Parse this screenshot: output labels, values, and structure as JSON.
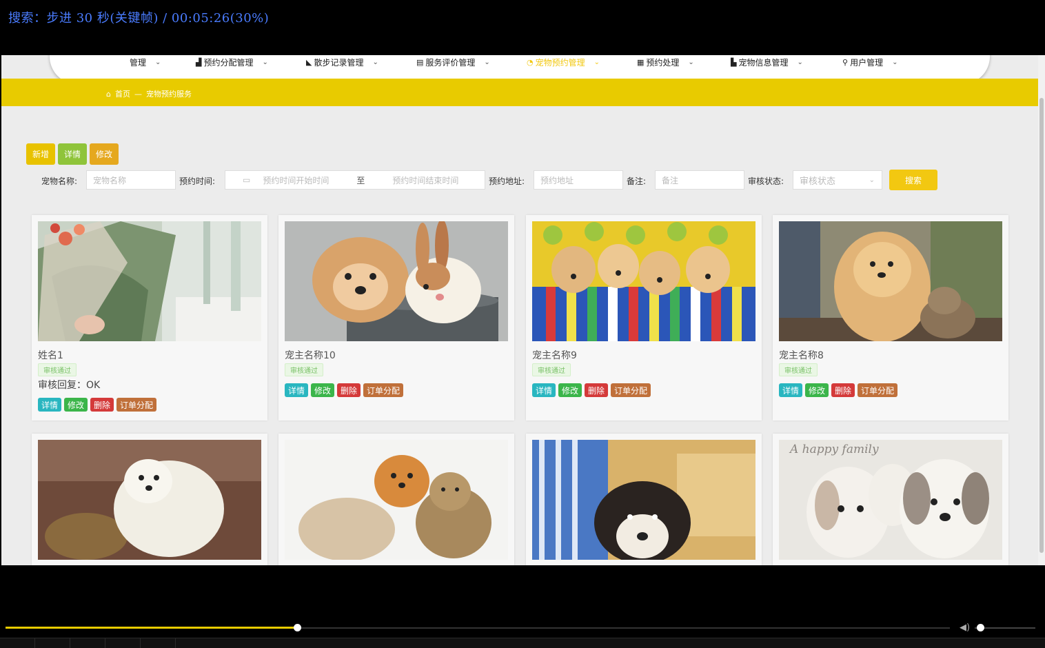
{
  "osd": {
    "text": "搜索：步进 30 秒(关键帧) / 00:05:26(30%)"
  },
  "nav": {
    "items": [
      {
        "label": "管理",
        "icon": ""
      },
      {
        "label": "预约分配管理",
        "icon": "▟"
      },
      {
        "label": "散步记录管理",
        "icon": "◣"
      },
      {
        "label": "服务评价管理",
        "icon": "▤"
      },
      {
        "label": "宠物预约管理",
        "icon": "◔"
      },
      {
        "label": "预约处理",
        "icon": "▦"
      },
      {
        "label": "宠物信息管理",
        "icon": "▙"
      },
      {
        "label": "用户管理",
        "icon": "⚲"
      }
    ],
    "active": "宠物预约管理"
  },
  "breadcrumb": {
    "home": "首页",
    "separator": "—",
    "current": "宠物预约服务"
  },
  "actions": {
    "add": "新增",
    "detail": "详情",
    "edit": "修改"
  },
  "search": {
    "pet_name_label": "宠物名称:",
    "pet_name_placeholder": "宠物名称",
    "time_label": "预约时间:",
    "time_start_placeholder": "预约时间开始时间",
    "time_to": "至",
    "time_end_placeholder": "预约时间结束时间",
    "address_label": "预约地址:",
    "address_placeholder": "预约地址",
    "note_label": "备注:",
    "note_placeholder": "备注",
    "status_label": "审核状态:",
    "status_placeholder": "审核状态",
    "button": "搜索"
  },
  "cards": [
    {
      "name": "姓名1",
      "badge": "审核通过",
      "reply": "审核回复：OK",
      "btns": [
        "详情",
        "修改",
        "删除",
        "订单分配"
      ]
    },
    {
      "name": "宠主名称10",
      "badge": "审核通过",
      "btns": [
        "详情",
        "修改",
        "删除",
        "订单分配"
      ]
    },
    {
      "name": "宠主名称9",
      "badge": "审核通过",
      "btns": [
        "详情",
        "修改",
        "删除",
        "订单分配"
      ]
    },
    {
      "name": "宠主名称8",
      "badge": "审核通过",
      "btns": [
        "详情",
        "修改",
        "删除",
        "订单分配"
      ]
    }
  ],
  "second_row_image_text": "A happy family",
  "player": {
    "progress": 0.3
  },
  "colors": {
    "accent": "#f2c811",
    "breadcrumb_bar": "#e8cb00",
    "detail": "#29b6c0",
    "edit": "#3bb54a",
    "delete": "#d43a3a",
    "assign": "#c0703a",
    "osd_text": "#4a7cff"
  }
}
